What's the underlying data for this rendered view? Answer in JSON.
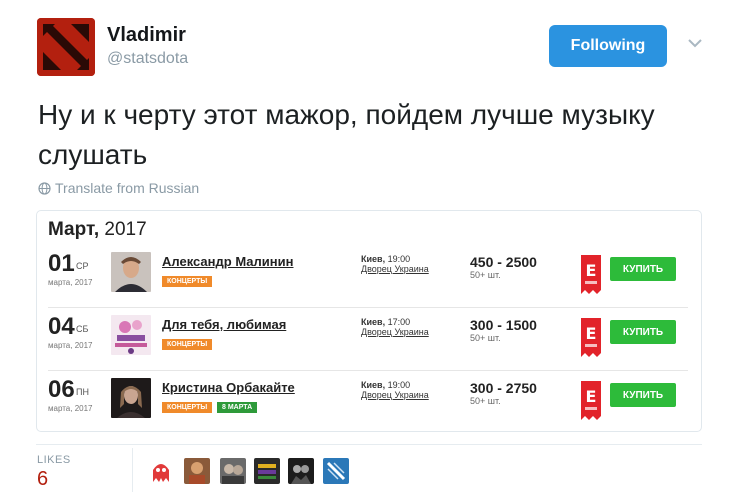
{
  "user": {
    "name": "Vladimir",
    "handle": "@statsdota",
    "follow_label": "Following"
  },
  "tweet": {
    "text": "Ну и к черту этот мажор, пойдем лучше музыку слушать",
    "translate_label": "Translate from Russian"
  },
  "card": {
    "month": "Март,",
    "year": " 2017",
    "events": [
      {
        "day": "01",
        "dow": "СР",
        "month": "марта, 2017",
        "artist": "Александр Малинин",
        "tags": [
          {
            "text": "КОНЦЕРТЫ",
            "color": "orange"
          }
        ],
        "city": "Киев,",
        "time": " 19:00",
        "venue": "Дворец Украина",
        "price": "450 - 2500",
        "qty": "50+ шт.",
        "buy_label": "КУПИТЬ"
      },
      {
        "day": "04",
        "dow": "СБ",
        "month": "марта, 2017",
        "artist": "Для тебя, любимая",
        "tags": [
          {
            "text": "КОНЦЕРТЫ",
            "color": "orange"
          }
        ],
        "city": "Киев,",
        "time": " 17:00",
        "venue": "Дворец Украина",
        "price": "300 - 1500",
        "qty": "50+ шт.",
        "buy_label": "КУПИТЬ"
      },
      {
        "day": "06",
        "dow": "ПН",
        "month": "марта, 2017",
        "artist": "Кристина Орбакайте",
        "tags": [
          {
            "text": "КОНЦЕРТЫ",
            "color": "orange"
          },
          {
            "text": "8 МАРТА",
            "color": "green"
          }
        ],
        "city": "Киев,",
        "time": " 19:00",
        "venue": "Дворец Украина",
        "price": "300 - 2750",
        "qty": "50+ шт.",
        "buy_label": "КУПИТЬ"
      }
    ]
  },
  "likes": {
    "label": "LIKES",
    "count": "6"
  },
  "colors": {
    "follow_blue": "#2b93e0",
    "buy_green": "#2dbb3a",
    "brand_red": "#b3200f",
    "tag_orange": "#f08a2a",
    "tag_green": "#2e9a3a"
  }
}
